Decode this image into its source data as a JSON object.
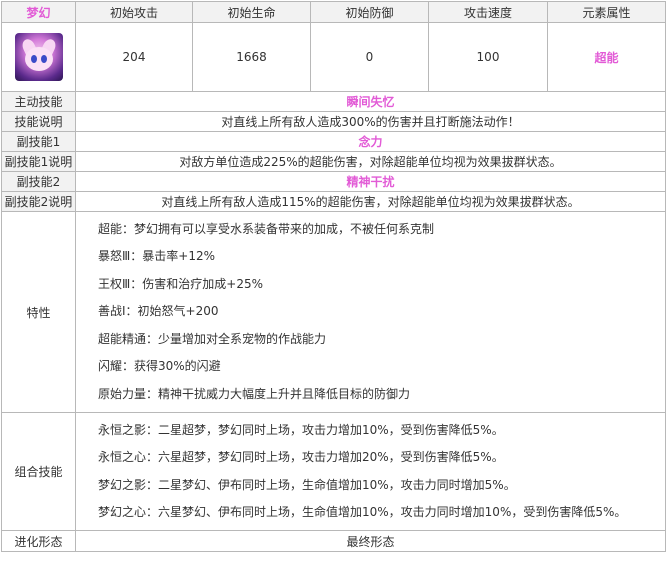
{
  "header": {
    "name": "梦幻",
    "columns": [
      "初始攻击",
      "初始生命",
      "初始防御",
      "攻击速度",
      "元素属性"
    ]
  },
  "stats": {
    "attack": "204",
    "hp": "1668",
    "defense": "0",
    "speed": "100",
    "element": "超能"
  },
  "rows": {
    "active_skill_label": "主动技能",
    "active_skill": "瞬间失忆",
    "skill_desc_label": "技能说明",
    "skill_desc": "对直线上所有敌人造成300%的伤害并且打断施法动作！",
    "sub1_label": "副技能1",
    "sub1": "念力",
    "sub1_desc_label": "副技能1说明",
    "sub1_desc": "对敌方单位造成225%的超能伤害，对除超能单位均视为效果拔群状态。",
    "sub2_label": "副技能2",
    "sub2": "精神干扰",
    "sub2_desc_label": "副技能2说明",
    "sub2_desc": "对直线上所有敌人造成115%的超能伤害，对除超能单位均视为效果拔群状态。",
    "traits_label": "特性",
    "combo_label": "组合技能",
    "evolution_label": "进化形态",
    "evolution": "最终形态"
  },
  "traits": [
    "超能：梦幻拥有可以享受水系装备带来的加成，不被任何系克制",
    "暴怒Ⅲ：暴击率+12%",
    "王权Ⅲ：伤害和治疗加成+25%",
    "善战Ⅰ：初始怒气+200",
    "超能精通：少量增加对全系宠物的作战能力",
    "闪耀：获得30%的闪避",
    "原始力量：精神干扰威力大幅度上升并且降低目标的防御力"
  ],
  "combos": [
    "永恒之影：二星超梦，梦幻同时上场，攻击力增加10%，受到伤害降低5%。",
    "永恒之心：六星超梦，梦幻同时上场，攻击力增加20%，受到伤害降低5%。",
    "梦幻之影：二星梦幻、伊布同时上场，生命值增加10%，攻击力同时增加5%。",
    "梦幻之心：六星梦幻、伊布同时上场，生命值增加10%，攻击力同时增加10%，受到伤害降低5%。"
  ]
}
